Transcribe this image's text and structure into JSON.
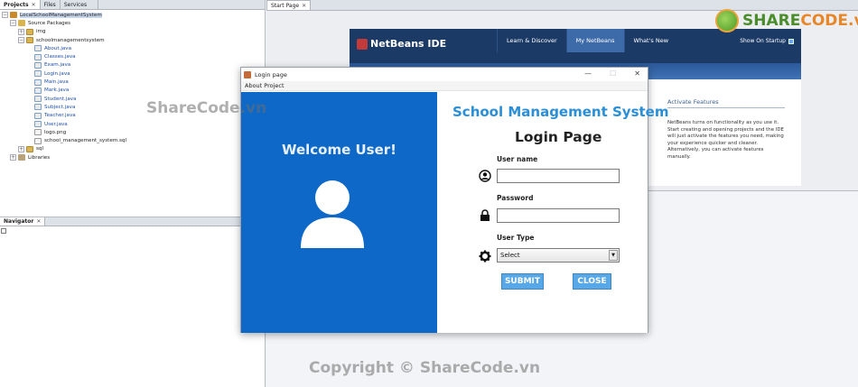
{
  "ide": {
    "left_tabs": [
      "Projects",
      "Files",
      "Services"
    ],
    "tree": [
      {
        "indent": 0,
        "expander": "−",
        "icon": "proj",
        "label": "LocalSchoolManagementSystem",
        "selected": true
      },
      {
        "indent": 1,
        "expander": "−",
        "icon": "pkgs",
        "label": "Source Packages"
      },
      {
        "indent": 2,
        "expander": "+",
        "icon": "pkg",
        "label": "img"
      },
      {
        "indent": 2,
        "expander": "−",
        "icon": "pkg",
        "label": "schoolmanagementsystem"
      },
      {
        "indent": 3,
        "expander": "",
        "icon": "java",
        "label": "About.java",
        "blue": true
      },
      {
        "indent": 3,
        "expander": "",
        "icon": "java",
        "label": "Classes.java",
        "blue": true
      },
      {
        "indent": 3,
        "expander": "",
        "icon": "java",
        "label": "Exam.java",
        "blue": true
      },
      {
        "indent": 3,
        "expander": "",
        "icon": "java",
        "label": "Login.java",
        "blue": true
      },
      {
        "indent": 3,
        "expander": "",
        "icon": "java",
        "label": "Main.java",
        "blue": true
      },
      {
        "indent": 3,
        "expander": "",
        "icon": "java",
        "label": "Mark.java",
        "blue": true
      },
      {
        "indent": 3,
        "expander": "",
        "icon": "java",
        "label": "Student.java",
        "blue": true
      },
      {
        "indent": 3,
        "expander": "",
        "icon": "java",
        "label": "Subject.java",
        "blue": true
      },
      {
        "indent": 3,
        "expander": "",
        "icon": "java",
        "label": "Teacher.java",
        "blue": true
      },
      {
        "indent": 3,
        "expander": "",
        "icon": "java",
        "label": "User.java",
        "blue": true
      },
      {
        "indent": 3,
        "expander": "",
        "icon": "file",
        "label": "logo.png"
      },
      {
        "indent": 3,
        "expander": "",
        "icon": "file",
        "label": "school_management_system.sql"
      },
      {
        "indent": 2,
        "expander": "+",
        "icon": "pkg",
        "label": "sql"
      },
      {
        "indent": 1,
        "expander": "+",
        "icon": "lib",
        "label": "Libraries"
      }
    ],
    "navigator_tab": "Navigator",
    "editor_tab": "Start Page",
    "close_glyph": "✕"
  },
  "start_page": {
    "logo": "NetBeans IDE",
    "nav": [
      "Learn & Discover",
      "My NetBeans",
      "What's New"
    ],
    "active_nav": 1,
    "show_on_startup": "Show On Startup",
    "feature_title": "Activate Features",
    "feature_text": "NetBeans turns on functionality as you use it. Start creating and opening projects and the IDE will just activate the features you need, making your experience quicker and cleaner. Alternatively, you can activate features manually."
  },
  "dialog": {
    "title": "Login page",
    "menu": "About Project",
    "welcome": "Welcome User!",
    "system_title": "School Management System",
    "page_title": "Login Page",
    "username_label": "User name",
    "username_value": "",
    "password_label": "Password",
    "password_value": "",
    "usertype_label": "User Type",
    "usertype_selected": "Select",
    "submit": "SUBMIT",
    "close": "CLOSE",
    "win_minimize": "—",
    "win_maximize": "☐",
    "win_close": "✕"
  },
  "watermarks": {
    "top": "ShareCode.vn",
    "bottom": "Copyright © ShareCode.vn",
    "logo_share": "SHARE",
    "logo_code": "CODE.vn"
  },
  "colors": {
    "dialog_left": "#0d68c7",
    "system_title": "#2a8fd6",
    "button": "#58a7e6",
    "netbeans_header": "#1c3a66"
  }
}
